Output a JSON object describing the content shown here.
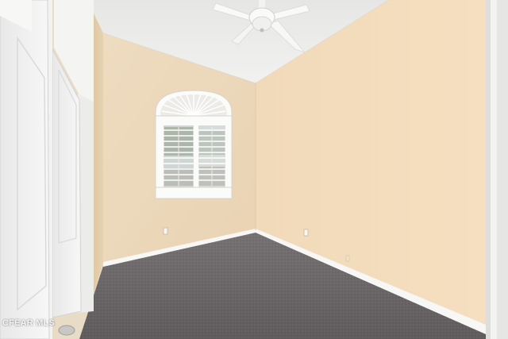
{
  "photo": {
    "subject": "empty-bedroom",
    "colors": {
      "back_wall": "#f0dcbd",
      "right_wall": "#f3dab8",
      "ceiling": "#ebebea",
      "carpet": "#6e6a6c",
      "trim": "#f7f7f5"
    }
  },
  "watermark": {
    "text": "CFEAR MLS"
  }
}
